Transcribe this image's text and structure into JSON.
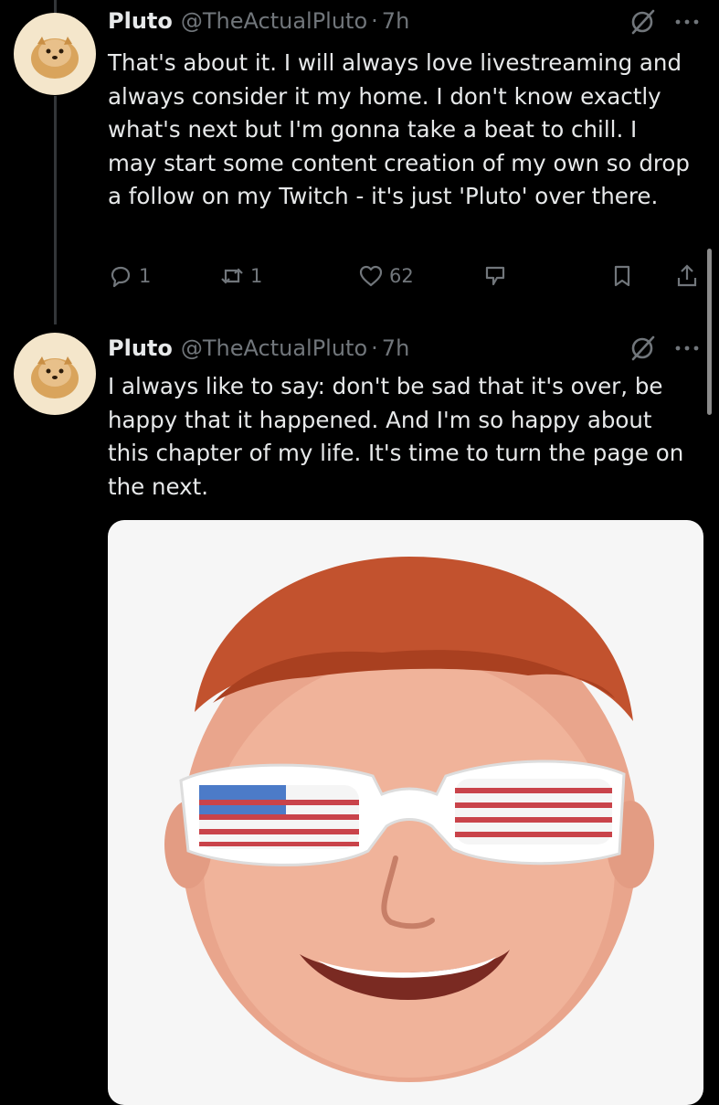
{
  "tweets": [
    {
      "author_name": "Pluto",
      "handle": "@TheActualPluto",
      "separator": "·",
      "time": "7h",
      "text": "That's about it. I will always love livestreaming and always consider it my home. I don't know exactly what's next but I'm gonna take a beat to chill. I may start some content creation of my own so drop a follow on my Twitch - it's just 'Pluto' over there.",
      "replies": "1",
      "reposts": "1",
      "likes": "62"
    },
    {
      "author_name": "Pluto",
      "handle": "@TheActualPluto",
      "separator": "·",
      "time": "7h",
      "text": "I always like to say: don't be sad that it's over, be happy that it happened. And I'm so happy about this chapter of my life. It's time to turn the page on the next."
    }
  ],
  "icons": {
    "avatar": "pomeranian-avatar",
    "grok": "grok-icon",
    "more": "more-icon",
    "reply": "reply-icon",
    "repost": "repost-icon",
    "like": "heart-icon",
    "analytics": "analytics-icon",
    "bookmark": "bookmark-icon",
    "share": "share-icon"
  },
  "colors": {
    "background": "#000000",
    "primary_text": "#e7e9ea",
    "secondary_text": "#71767b"
  }
}
